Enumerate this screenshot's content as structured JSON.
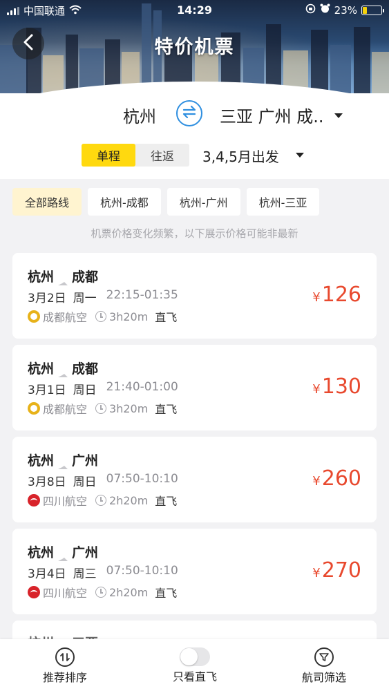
{
  "status_bar": {
    "carrier": "中国联通",
    "time": "14:29",
    "battery": "23%"
  },
  "header": {
    "title": "特价机票"
  },
  "search": {
    "from_city": "杭州",
    "to_cities": "三亚 广州 成..",
    "trip_types": [
      "单程",
      "往返"
    ],
    "active_trip_type": "单程",
    "departure": "3,4,5月出发"
  },
  "route_tabs": [
    "全部路线",
    "杭州-成都",
    "杭州-广州",
    "杭州-三亚"
  ],
  "notice": "机票价格变化频繁，以下展示价格可能非最新",
  "flights": [
    {
      "from": "杭州",
      "to": "成都",
      "date": "3月2日",
      "weekday": "周一",
      "time": "22:15-01:35",
      "airline": "成都航空",
      "airline_logo": "chengdu-airlines-logo",
      "duration": "3h20m",
      "stop": "直飞",
      "currency": "¥",
      "price": "126"
    },
    {
      "from": "杭州",
      "to": "成都",
      "date": "3月1日",
      "weekday": "周日",
      "time": "21:40-01:00",
      "airline": "成都航空",
      "airline_logo": "chengdu-airlines-logo",
      "duration": "3h20m",
      "stop": "直飞",
      "currency": "¥",
      "price": "130"
    },
    {
      "from": "杭州",
      "to": "广州",
      "date": "3月8日",
      "weekday": "周日",
      "time": "07:50-10:10",
      "airline": "四川航空",
      "airline_logo": "sichuan-airlines-logo",
      "duration": "2h20m",
      "stop": "直飞",
      "currency": "¥",
      "price": "260"
    },
    {
      "from": "杭州",
      "to": "广州",
      "date": "3月4日",
      "weekday": "周三",
      "time": "07:50-10:10",
      "airline": "四川航空",
      "airline_logo": "sichuan-airlines-logo",
      "duration": "2h20m",
      "stop": "直飞",
      "currency": "¥",
      "price": "270"
    }
  ],
  "partial_flight": {
    "from": "杭州",
    "to": "三亚"
  },
  "bottom_bar": {
    "sort_label": "推荐排序",
    "direct_only_label": "只看直飞",
    "airline_filter_label": "航司筛选"
  },
  "colors": {
    "accent_yellow": "#ffd90f",
    "price_red": "#e8492e",
    "swap_blue": "#2f8fe0"
  }
}
